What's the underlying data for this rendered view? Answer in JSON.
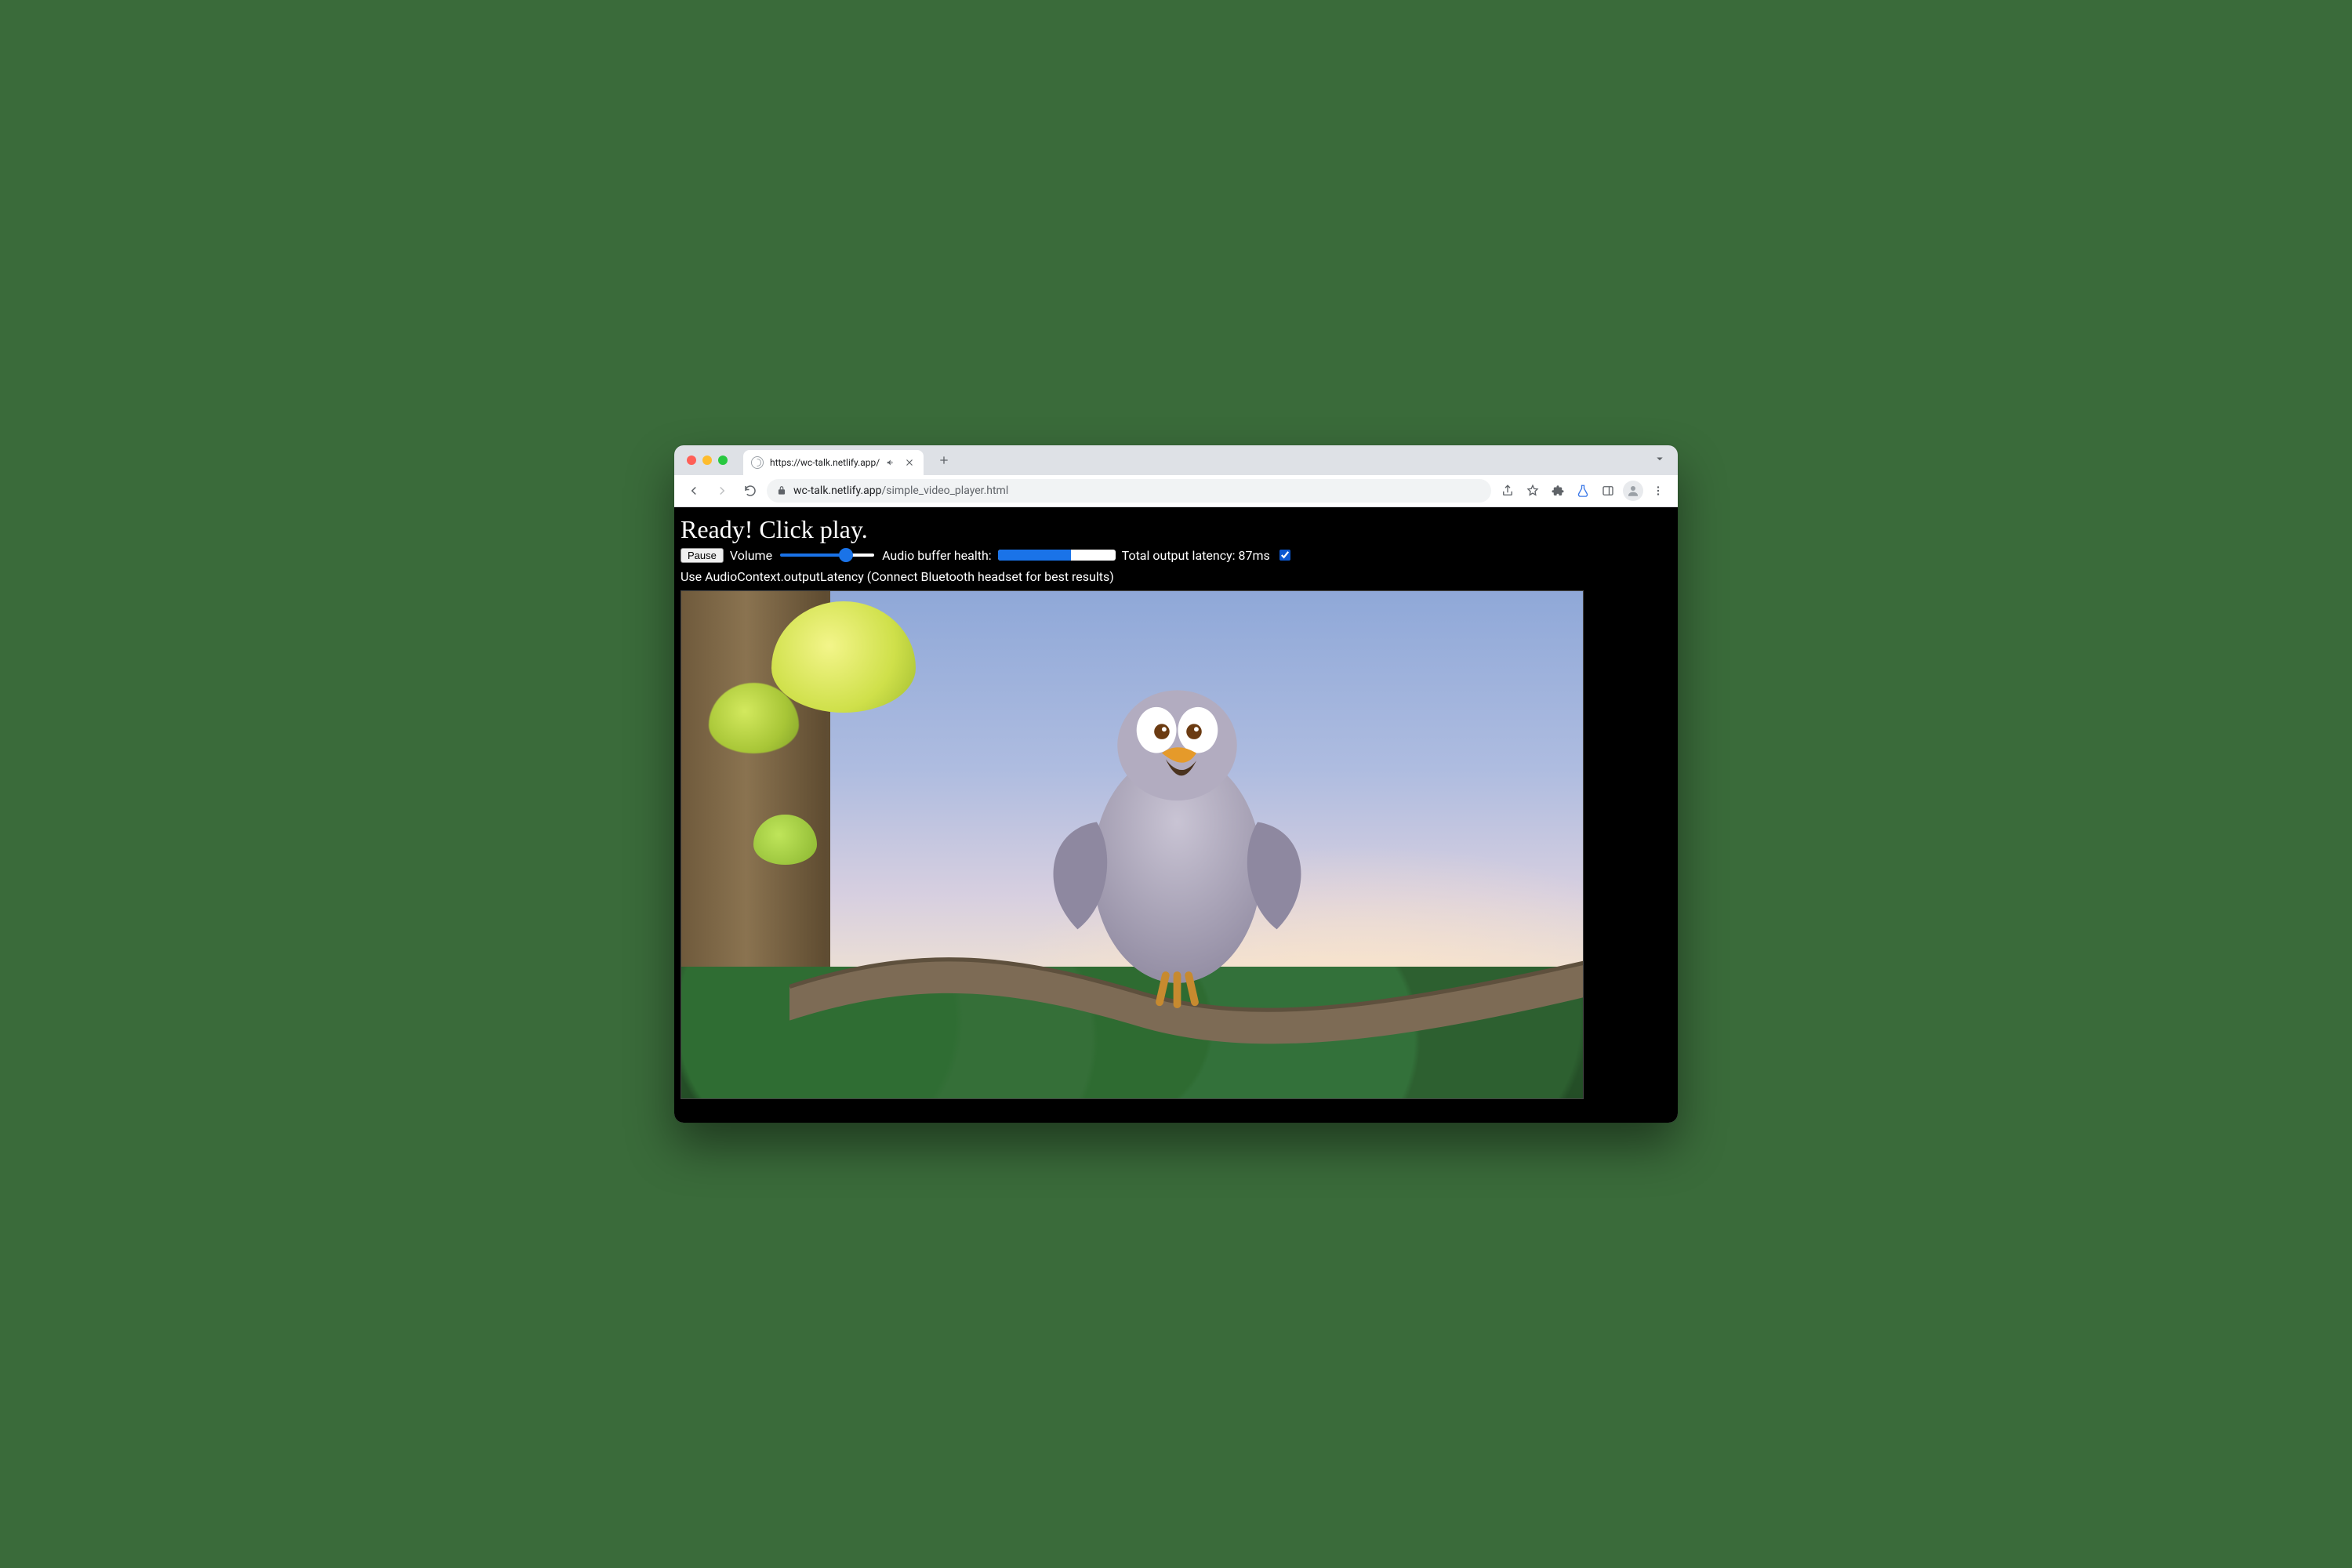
{
  "browser": {
    "tab_title": "https://wc-talk.netlify.app/",
    "url_host": "wc-talk.netlify.app",
    "url_path": "/simple_video_player.html"
  },
  "page": {
    "status_heading": "Ready! Click play.",
    "pause_label": "Pause",
    "volume_label": "Volume",
    "volume_percent": 73,
    "buffer_label": "Audio buffer health:",
    "buffer_percent": 62,
    "latency_label_prefix": "Total output latency: ",
    "latency_value": "87ms",
    "checkbox_checked": true,
    "checkbox_label": "Use AudioContext.outputLatency (Connect Bluetooth headset for best results)"
  }
}
